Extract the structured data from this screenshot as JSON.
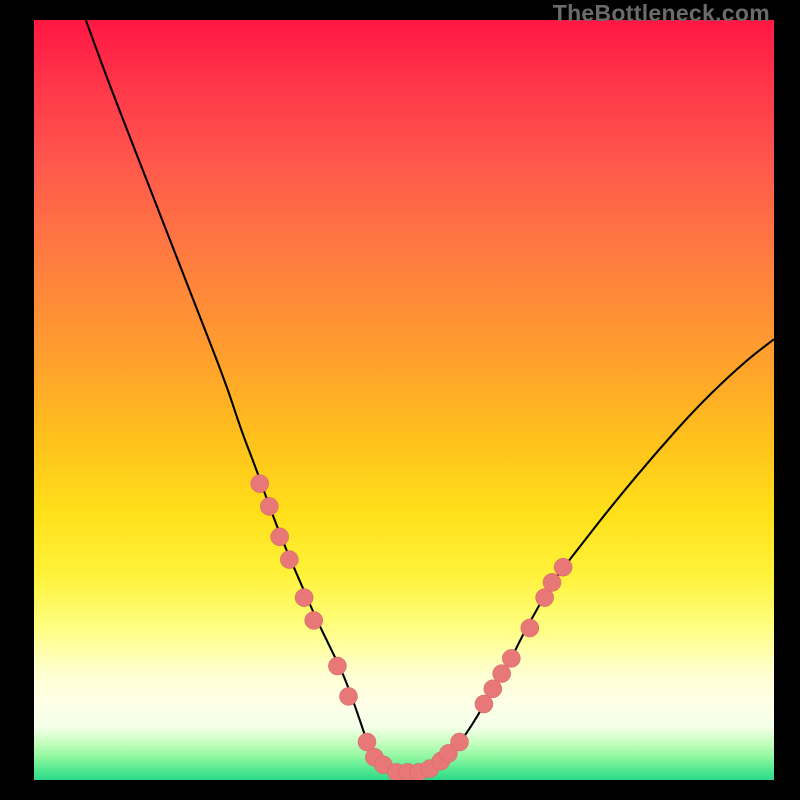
{
  "watermark": "TheBottleneck.com",
  "colors": {
    "background": "#000000",
    "gradient_top": "#ff1744",
    "gradient_bottom": "#2dd88a",
    "curve": "#000000",
    "dots": "#e87878"
  },
  "chart_data": {
    "type": "line",
    "title": "",
    "xlabel": "",
    "ylabel": "",
    "xlim": [
      0,
      100
    ],
    "ylim": [
      0,
      100
    ],
    "series": [
      {
        "name": "bottleneck-curve",
        "x": [
          7,
          10,
          14,
          18,
          22,
          26,
          28,
          30,
          32,
          34,
          36,
          38,
          40,
          42,
          44,
          45,
          46.5,
          48,
          50,
          52,
          54,
          56,
          58,
          60,
          62,
          64,
          66,
          68,
          70,
          74,
          78,
          84,
          90,
          96,
          100
        ],
        "y": [
          100,
          92,
          82,
          72,
          62,
          52,
          46,
          41,
          35.5,
          30.5,
          26,
          21.5,
          17.5,
          13.5,
          8,
          5,
          2.5,
          1.5,
          1,
          1,
          1.5,
          3,
          5.5,
          8.5,
          12,
          15,
          19,
          22.5,
          26,
          31,
          36,
          43,
          49.5,
          55,
          58
        ]
      }
    ],
    "chart_markers": {
      "name": "highlighted-points",
      "points": [
        {
          "x": 30.5,
          "y": 39
        },
        {
          "x": 31.8,
          "y": 36
        },
        {
          "x": 33.2,
          "y": 32
        },
        {
          "x": 34.5,
          "y": 29
        },
        {
          "x": 36.5,
          "y": 24
        },
        {
          "x": 37.8,
          "y": 21
        },
        {
          "x": 41.0,
          "y": 15
        },
        {
          "x": 42.5,
          "y": 11
        },
        {
          "x": 45.0,
          "y": 5
        },
        {
          "x": 46.0,
          "y": 3
        },
        {
          "x": 47.2,
          "y": 2
        },
        {
          "x": 49.0,
          "y": 1
        },
        {
          "x": 50.5,
          "y": 1
        },
        {
          "x": 52.0,
          "y": 1
        },
        {
          "x": 53.5,
          "y": 1.5
        },
        {
          "x": 55.0,
          "y": 2.5
        },
        {
          "x": 56.0,
          "y": 3.5
        },
        {
          "x": 57.5,
          "y": 5
        },
        {
          "x": 60.8,
          "y": 10
        },
        {
          "x": 62.0,
          "y": 12
        },
        {
          "x": 63.2,
          "y": 14
        },
        {
          "x": 64.5,
          "y": 16
        },
        {
          "x": 67.0,
          "y": 20
        },
        {
          "x": 69.0,
          "y": 24
        },
        {
          "x": 70.0,
          "y": 26
        },
        {
          "x": 71.5,
          "y": 28
        }
      ]
    }
  }
}
